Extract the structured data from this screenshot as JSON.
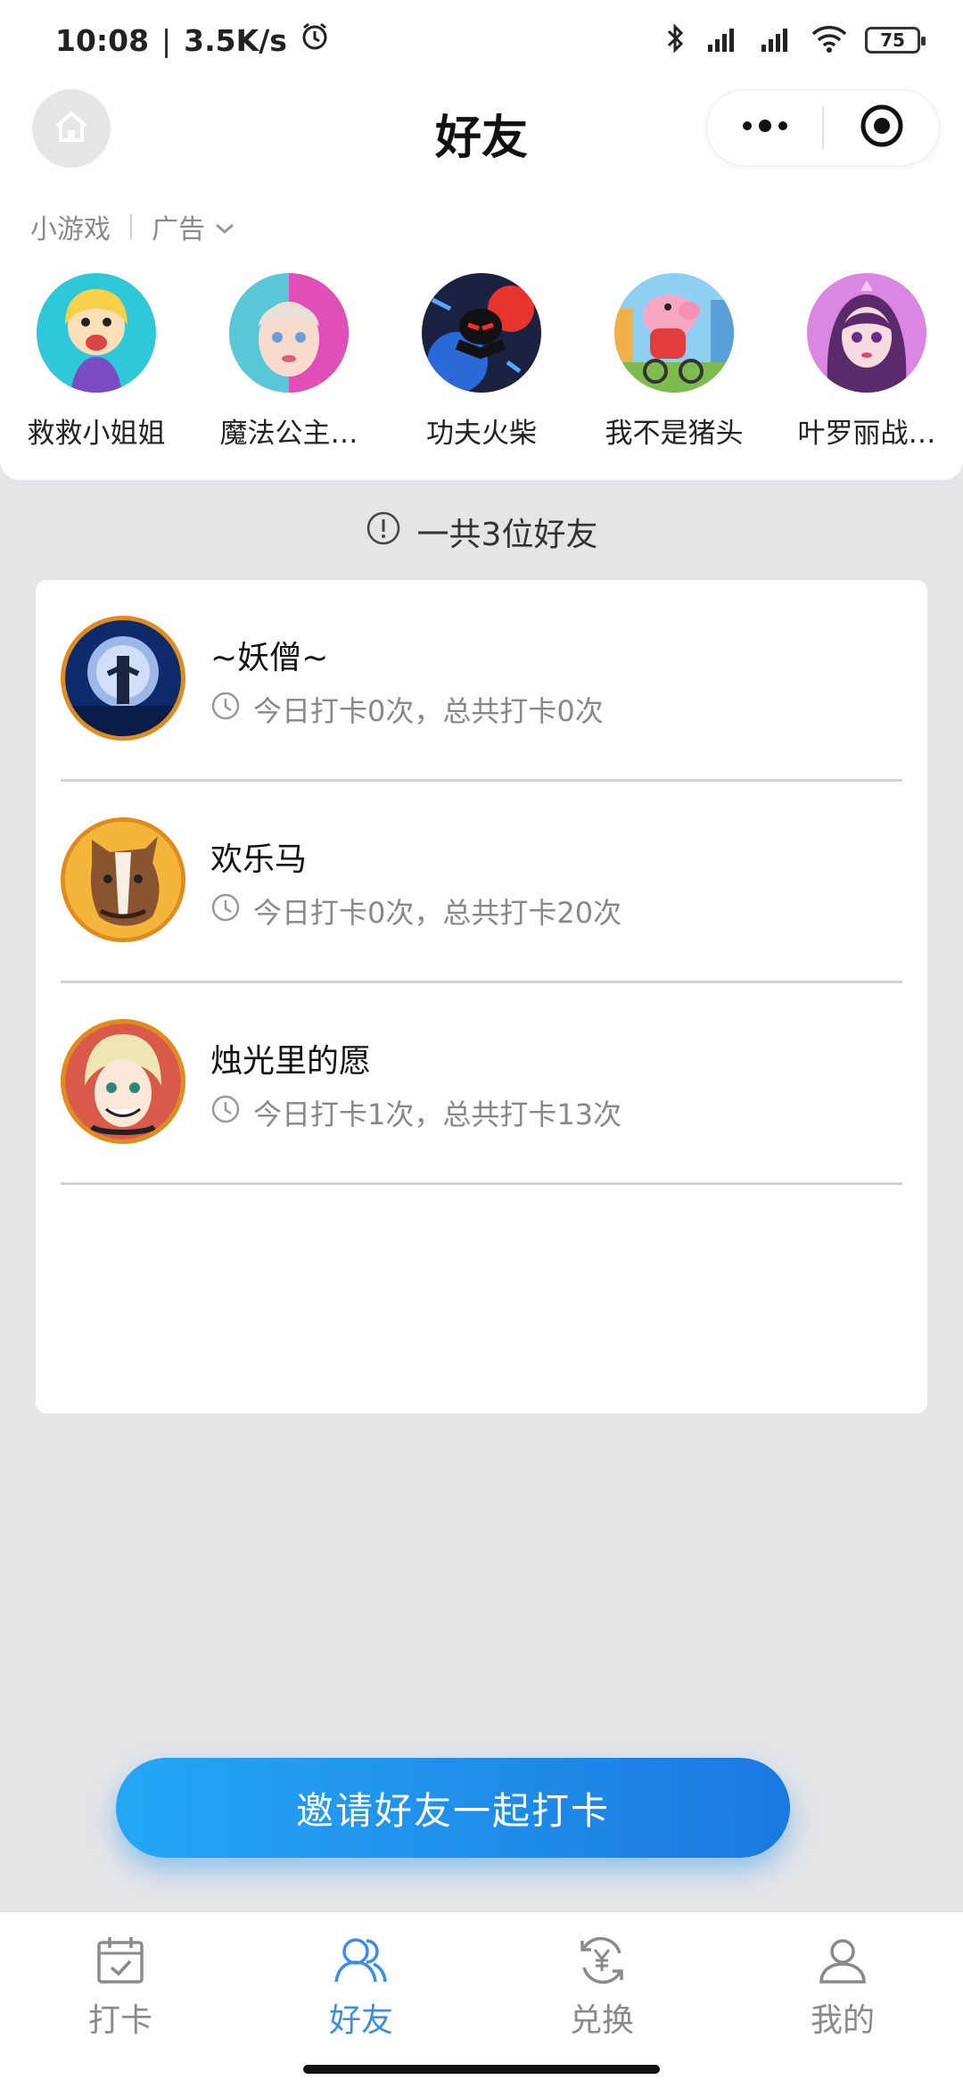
{
  "status_bar": {
    "time": "10:08",
    "speed": "3.5K/s",
    "battery": "75"
  },
  "nav": {
    "title": "好友"
  },
  "ad_panel": {
    "label": "小游戏",
    "ad_label": "广告",
    "games": [
      {
        "name": "救救小姐姐",
        "icon": "cartoon-girl-icon"
      },
      {
        "name": "魔法公主…",
        "icon": "princess-icon"
      },
      {
        "name": "功夫火柴",
        "icon": "stickman-icon"
      },
      {
        "name": "我不是猪头",
        "icon": "pig-icon"
      },
      {
        "name": "叶罗丽战…",
        "icon": "doll-icon"
      }
    ]
  },
  "friends_count": "一共3位好友",
  "friends": [
    {
      "name": "~妖僧~",
      "stats": "今日打卡0次，总共打卡0次"
    },
    {
      "name": "欢乐马",
      "stats": "今日打卡0次，总共打卡20次"
    },
    {
      "name": "烛光里的愿",
      "stats": "今日打卡1次，总共打卡13次"
    }
  ],
  "invite_button": "邀请好友一起打卡",
  "tabs": [
    {
      "label": "打卡",
      "active": false,
      "icon": "calendar-check-icon"
    },
    {
      "label": "好友",
      "active": true,
      "icon": "friends-icon"
    },
    {
      "label": "兑换",
      "active": false,
      "icon": "exchange-yen-icon"
    },
    {
      "label": "我的",
      "active": false,
      "icon": "user-icon"
    }
  ],
  "colors": {
    "accent": "#3a8ee8",
    "avatar_ring": "#e08b1c",
    "background": "#e5e5e8"
  }
}
